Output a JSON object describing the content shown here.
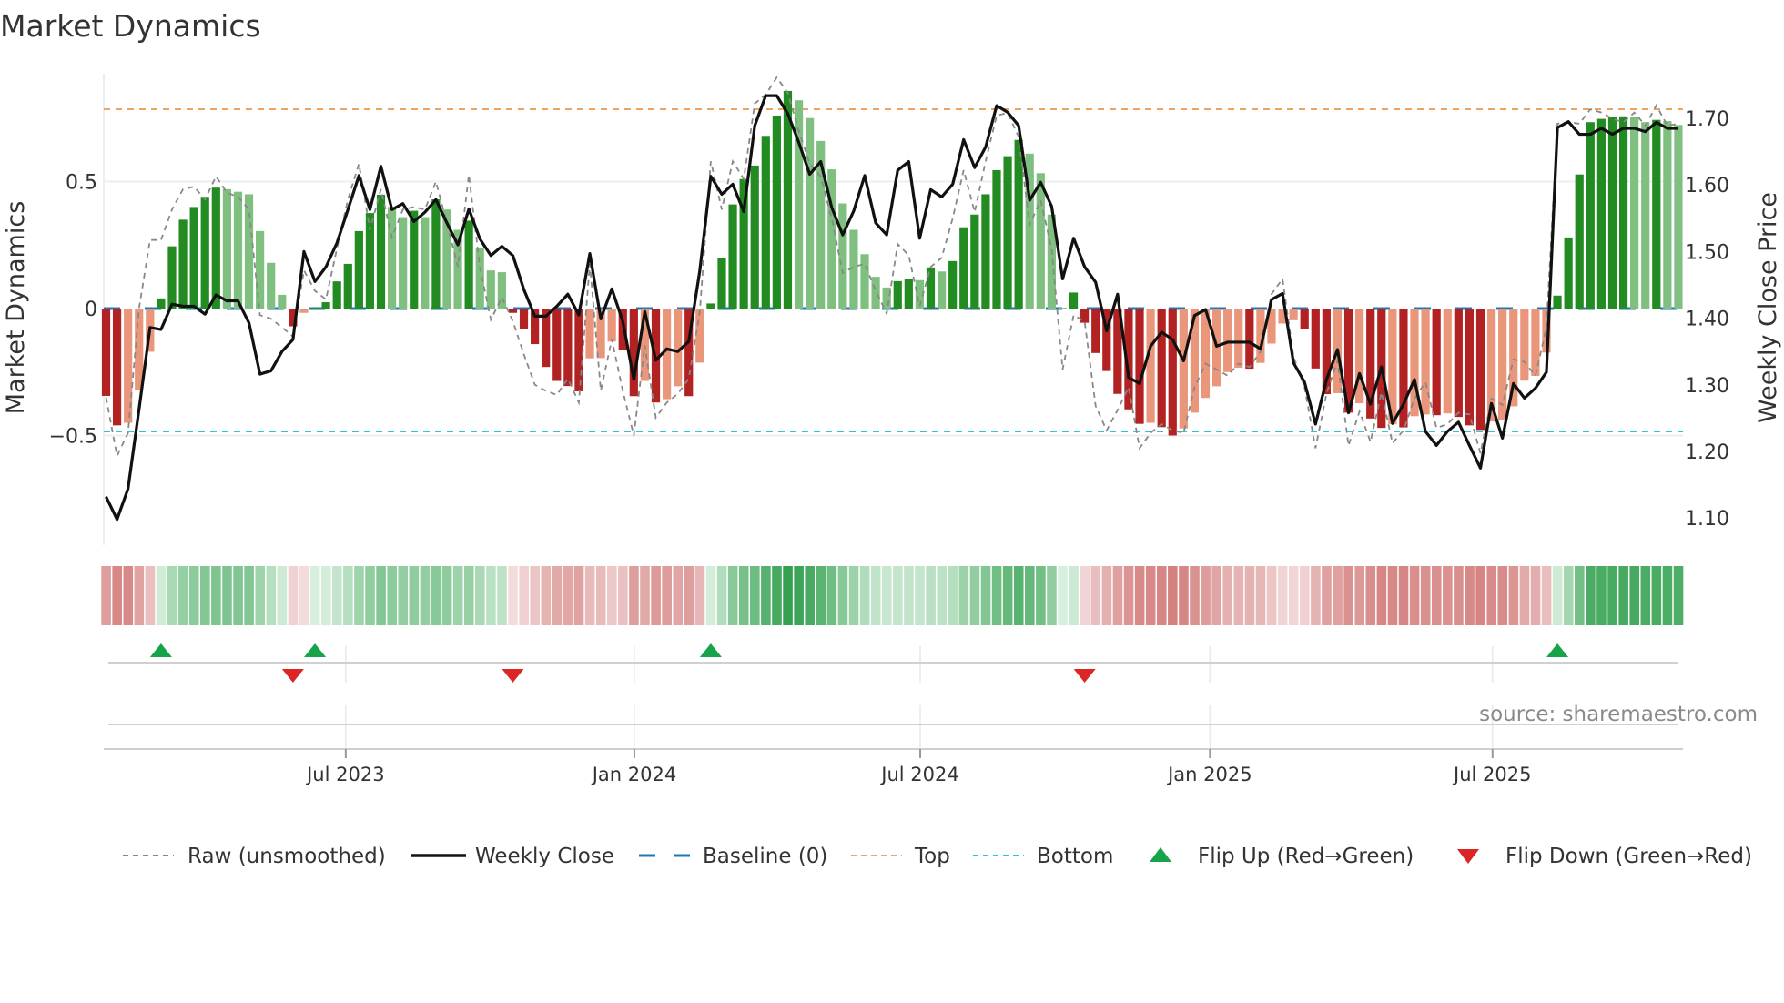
{
  "chart_data": {
    "type": "bar",
    "title": "Market Dynamics",
    "ylabel": "Market Dynamics",
    "y2label": "Weekly Close Price",
    "source": "source: sharemaestro.com",
    "ylim": [
      -0.86,
      0.93
    ],
    "y2lim": [
      1.07,
      1.79
    ],
    "yticks": [
      {
        "v": 0.5,
        "label": "0.5"
      },
      {
        "v": 0,
        "label": "0"
      },
      {
        "v": -0.5,
        "label": "−0.5"
      }
    ],
    "y2ticks": [
      {
        "v": 1.7,
        "label": "1.70"
      },
      {
        "v": 1.6,
        "label": "1.60"
      },
      {
        "v": 1.5,
        "label": "1.50"
      },
      {
        "v": 1.4,
        "label": "1.40"
      },
      {
        "v": 1.3,
        "label": "1.30"
      },
      {
        "v": 1.2,
        "label": "1.20"
      },
      {
        "v": 1.1,
        "label": "1.10"
      }
    ],
    "xticks": [
      {
        "week": 21.8,
        "label": "Jul 2023"
      },
      {
        "week": 48.05,
        "label": "Jan 2024"
      },
      {
        "week": 74.05,
        "label": "Jul 2024"
      },
      {
        "week": 100.4,
        "label": "Jan 2025"
      },
      {
        "week": 126.1,
        "label": "Jul 2025"
      }
    ],
    "top_level": 0.785,
    "bottom_level": -0.484,
    "baseline": 0,
    "colors": {
      "up_strong": "#228b22",
      "up_weak": "#7fbf7f",
      "down_strong": "#b22222",
      "down_weak": "#e9967a",
      "raw": "#888888",
      "close": "#111111",
      "baseline": "#1f77b4",
      "top": "#f0a35e",
      "bottom": "#2ec4d6",
      "flip_up": "#16a34a",
      "flip_down": "#dc2626"
    },
    "series": [
      {
        "name": "Market Dynamics (smoothed)",
        "kind": "bar",
        "values": [
          -0.344,
          -0.46,
          -0.45,
          -0.32,
          -0.17,
          0.04,
          0.245,
          0.35,
          0.4,
          0.44,
          0.476,
          0.47,
          0.46,
          0.45,
          0.305,
          0.18,
          0.054,
          -0.07,
          -0.017,
          0.005,
          0.025,
          0.107,
          0.176,
          0.305,
          0.376,
          0.448,
          0.4,
          0.36,
          0.385,
          0.36,
          0.43,
          0.39,
          0.31,
          0.346,
          0.238,
          0.15,
          0.143,
          -0.017,
          -0.08,
          -0.14,
          -0.23,
          -0.285,
          -0.305,
          -0.326,
          -0.196,
          -0.195,
          -0.13,
          -0.163,
          -0.345,
          -0.285,
          -0.37,
          -0.357,
          -0.306,
          -0.345,
          -0.213,
          0.02,
          0.198,
          0.41,
          0.51,
          0.563,
          0.68,
          0.76,
          0.857,
          0.82,
          0.75,
          0.66,
          0.548,
          0.414,
          0.31,
          0.214,
          0.125,
          0.083,
          0.108,
          0.115,
          0.112,
          0.162,
          0.146,
          0.187,
          0.32,
          0.37,
          0.45,
          0.545,
          0.6,
          0.664,
          0.61,
          0.533,
          0.37,
          0.003,
          0.063,
          -0.056,
          -0.175,
          -0.246,
          -0.336,
          -0.397,
          -0.454,
          -0.45,
          -0.467,
          -0.5,
          -0.472,
          -0.41,
          -0.352,
          -0.306,
          -0.25,
          -0.233,
          -0.237,
          -0.214,
          -0.138,
          -0.059,
          -0.046,
          -0.082,
          -0.236,
          -0.337,
          -0.333,
          -0.41,
          -0.373,
          -0.433,
          -0.47,
          -0.455,
          -0.468,
          -0.424,
          -0.417,
          -0.42,
          -0.413,
          -0.427,
          -0.46,
          -0.478,
          -0.445,
          -0.44,
          -0.385,
          -0.284,
          -0.265,
          -0.173,
          0.051,
          0.28,
          0.528,
          0.734,
          0.747,
          0.753,
          0.757,
          0.756,
          0.734,
          0.743,
          0.738,
          0.723
        ]
      },
      {
        "name": "Raw (unsmoothed)",
        "kind": "line",
        "axis": "left",
        "values": [
          -0.35,
          -0.58,
          -0.49,
          0.0,
          0.27,
          0.27,
          0.39,
          0.47,
          0.48,
          0.43,
          0.52,
          0.456,
          0.44,
          0.39,
          -0.026,
          -0.04,
          -0.074,
          -0.11,
          0.15,
          0.07,
          0.036,
          0.236,
          0.43,
          0.57,
          0.31,
          0.47,
          0.28,
          0.39,
          0.4,
          0.39,
          0.5,
          0.337,
          0.164,
          0.527,
          0.164,
          -0.044,
          0.045,
          -0.05,
          -0.18,
          -0.3,
          -0.324,
          -0.34,
          -0.276,
          -0.37,
          0.176,
          -0.324,
          -0.12,
          -0.324,
          -0.5,
          -0.145,
          -0.43,
          -0.37,
          -0.336,
          -0.276,
          -0.014,
          0.58,
          0.39,
          0.58,
          0.51,
          0.807,
          0.843,
          0.91,
          0.85,
          0.7,
          0.57,
          0.52,
          0.355,
          0.14,
          0.164,
          0.176,
          0.07,
          -0.02,
          0.254,
          0.21,
          0.01,
          0.164,
          0.2,
          0.355,
          0.545,
          0.38,
          0.58,
          0.76,
          0.77,
          0.676,
          0.33,
          0.426,
          0.236,
          -0.24,
          -0.026,
          -0.05,
          -0.383,
          -0.48,
          -0.4,
          -0.31,
          -0.55,
          -0.49,
          -0.455,
          -0.48,
          -0.49,
          -0.31,
          -0.217,
          -0.24,
          -0.264,
          -0.217,
          -0.23,
          -0.17,
          0.057,
          0.117,
          -0.19,
          -0.31,
          -0.55,
          -0.336,
          -0.205,
          -0.54,
          -0.405,
          -0.525,
          -0.33,
          -0.53,
          -0.48,
          -0.354,
          -0.29,
          -0.47,
          -0.455,
          -0.41,
          -0.417,
          -0.57,
          -0.354,
          -0.38,
          -0.2,
          -0.21,
          -0.265,
          -0.074,
          0.728,
          0.734,
          0.728,
          0.785,
          0.772,
          0.747,
          0.734,
          0.772,
          0.72,
          0.8,
          0.72,
          0.728
        ]
      },
      {
        "name": "Weekly Close",
        "kind": "line",
        "axis": "right",
        "values": [
          1.132,
          1.098,
          1.144,
          1.263,
          1.386,
          1.383,
          1.421,
          1.418,
          1.418,
          1.406,
          1.435,
          1.426,
          1.426,
          1.393,
          1.316,
          1.321,
          1.35,
          1.368,
          1.5,
          1.455,
          1.477,
          1.513,
          1.563,
          1.614,
          1.563,
          1.628,
          1.563,
          1.572,
          1.545,
          1.559,
          1.578,
          1.543,
          1.51,
          1.564,
          1.519,
          1.494,
          1.508,
          1.494,
          1.443,
          1.403,
          1.403,
          1.418,
          1.436,
          1.405,
          1.497,
          1.399,
          1.444,
          1.395,
          1.308,
          1.41,
          1.337,
          1.354,
          1.35,
          1.365,
          1.471,
          1.613,
          1.586,
          1.601,
          1.56,
          1.689,
          1.734,
          1.734,
          1.707,
          1.664,
          1.616,
          1.635,
          1.566,
          1.525,
          1.561,
          1.614,
          1.543,
          1.525,
          1.622,
          1.635,
          1.52,
          1.593,
          1.582,
          1.601,
          1.668,
          1.626,
          1.657,
          1.719,
          1.709,
          1.689,
          1.577,
          1.604,
          1.568,
          1.459,
          1.52,
          1.477,
          1.454,
          1.381,
          1.436,
          1.311,
          1.302,
          1.358,
          1.379,
          1.368,
          1.336,
          1.404,
          1.413,
          1.358,
          1.364,
          1.364,
          1.364,
          1.354,
          1.428,
          1.437,
          1.333,
          1.304,
          1.241,
          1.308,
          1.353,
          1.258,
          1.317,
          1.271,
          1.327,
          1.242,
          1.271,
          1.308,
          1.23,
          1.209,
          1.23,
          1.244,
          1.209,
          1.175,
          1.272,
          1.22,
          1.302,
          1.28,
          1.295,
          1.319,
          1.686,
          1.695,
          1.676,
          1.676,
          1.685,
          1.676,
          1.685,
          1.685,
          1.68,
          1.694,
          1.685,
          1.685
        ]
      }
    ],
    "flip_up_weeks": [
      6,
      20,
      56,
      133
    ],
    "flip_down_weeks": [
      18,
      38,
      90
    ],
    "legend_position": "bottom",
    "legend": [
      {
        "key": "raw",
        "label": "Raw (unsmoothed)"
      },
      {
        "key": "close",
        "label": "Weekly Close"
      },
      {
        "key": "baseline",
        "label": "Baseline (0)"
      },
      {
        "key": "top",
        "label": "Top"
      },
      {
        "key": "bottom",
        "label": "Bottom"
      },
      {
        "key": "flip_up",
        "label": "Flip Up (Red→Green)"
      },
      {
        "key": "flip_down",
        "label": "Flip Down (Green→Red)"
      }
    ]
  }
}
